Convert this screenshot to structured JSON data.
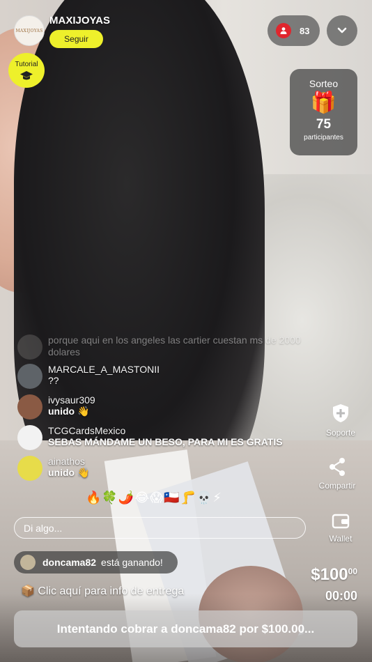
{
  "host": {
    "name": "MAXIJOYAS",
    "avatar_text": "MAXIJOYAS",
    "follow_label": "Seguir"
  },
  "tutorial": {
    "label": "Tutorial",
    "icon": "graduation-cap-icon"
  },
  "viewers": {
    "count": "83",
    "icon": "user-icon"
  },
  "collapse": {
    "icon": "chevron-down-icon"
  },
  "raffle": {
    "title": "Sorteo",
    "icon": "🎁",
    "count": "75",
    "subtitle": "participantes"
  },
  "chat": [
    {
      "user": "porque aqui en los angeles las cartier cuestan ms de 2000 dolares",
      "text": "",
      "faded": true,
      "avatar_color": "#6c6a68"
    },
    {
      "user": "MARCALE_A_MASTONII",
      "text": "??",
      "faded": false,
      "avatar_color": "#6f7478"
    },
    {
      "user": "ivysaur309",
      "text": "unido 👋",
      "faded": false,
      "avatar_color": "#8a5a44"
    },
    {
      "user": "TCGCardsMexico",
      "text": "SEBAS MÁNDAME UN BESO, PARA MI ES GRATIS",
      "faded": false,
      "avatar_color": "#f2f2f2"
    },
    {
      "user": "ainathos",
      "text": "unido 👋",
      "faded": false,
      "avatar_color": "#e7dc4a"
    }
  ],
  "reactions": "🔥🍀🌶️😂😱🇨🇱🦵💀⚡",
  "input": {
    "placeholder": "Di algo..."
  },
  "side_actions": [
    {
      "label": "Soporte",
      "icon": "shield-plus-icon"
    },
    {
      "label": "Compartir",
      "icon": "share-icon"
    },
    {
      "label": "Wallet",
      "icon": "wallet-icon"
    }
  ],
  "winner": {
    "user": "doncama82",
    "status": "está ganando!"
  },
  "delivery": {
    "icon": "📦",
    "text": "Clic aquí para info de entrega"
  },
  "bid": {
    "price": "$100",
    "cents": "00",
    "timer": "00:00"
  },
  "charge_button": {
    "label": "Intentando cobrar a doncama82 por $100.00..."
  },
  "colors": {
    "accent": "#eef02b",
    "live_red": "#e0262d"
  }
}
